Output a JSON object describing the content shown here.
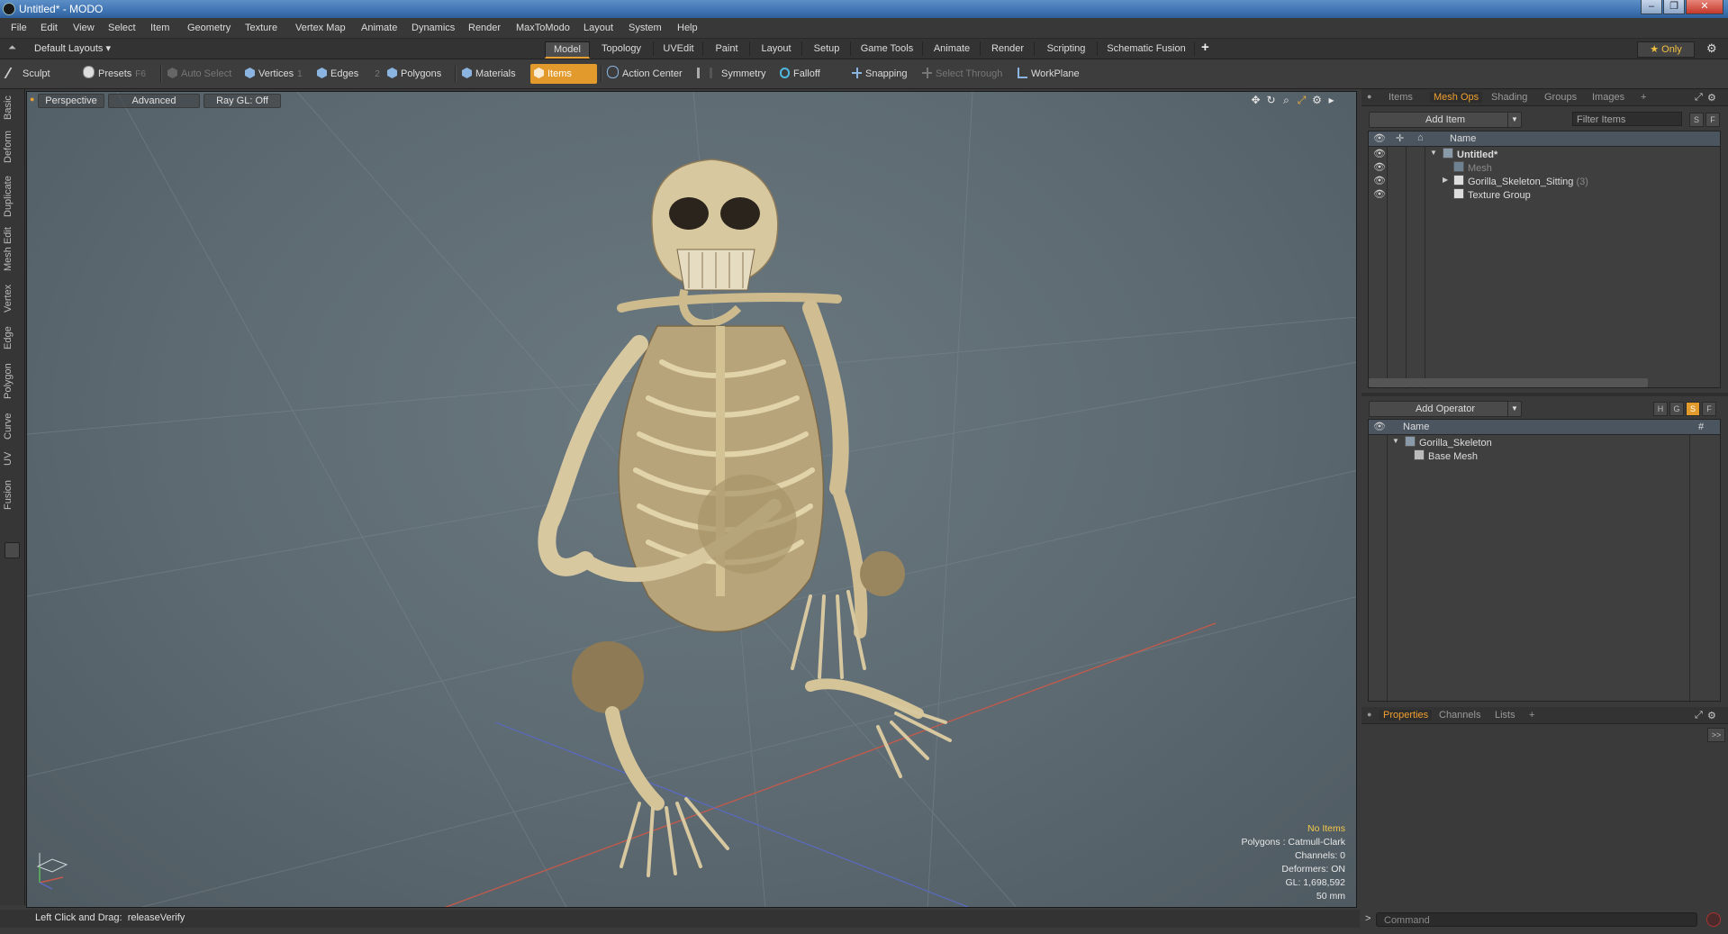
{
  "window": {
    "title": "Untitled* - MODO",
    "buttons": [
      "–",
      "❐",
      "✕"
    ]
  },
  "menubar": {
    "items": [
      "File",
      "Edit",
      "View",
      "Select",
      "Item",
      "Geometry",
      "Texture",
      "Vertex Map",
      "Animate",
      "Dynamics",
      "Render",
      "MaxToModo",
      "Layout",
      "System",
      "Help"
    ]
  },
  "layoutbar": {
    "layouts_label": "Default Layouts ▾",
    "tabs": [
      "Model",
      "Topology",
      "UVEdit",
      "Paint",
      "Layout",
      "Setup",
      "Game Tools",
      "Animate",
      "Render",
      "Scripting",
      "Schematic Fusion"
    ],
    "active_tab": "Model",
    "add_label": "+",
    "only_label": "★ Only",
    "gear": "⚙"
  },
  "toolbar": {
    "sculpt": "Sculpt",
    "presets": "Presets",
    "presets_shortcut": "F6",
    "auto_select": "Auto Select",
    "vertices": "Vertices",
    "vertices_num": "1",
    "edges": "Edges",
    "edges_num": "2",
    "polygons": "Polygons",
    "materials": "Materials",
    "items": "Items",
    "action_center": "Action Center",
    "symmetry": "Symmetry",
    "falloff": "Falloff",
    "snapping": "Snapping",
    "select_through": "Select Through",
    "workplane": "WorkPlane",
    "accent_color": "#e39a2c"
  },
  "left_tabs": [
    "Basic",
    "Deform",
    "Duplicate",
    "Mesh Edit",
    "Vertex",
    "Edge",
    "Polygon",
    "Curve",
    "UV",
    "Fusion"
  ],
  "viewport": {
    "perspective": "Perspective",
    "advanced": "Advanced",
    "raygl": "Ray GL: Off",
    "info": {
      "no_items": "No Items",
      "polygons": "Polygons : Catmull-Clark",
      "channels": "Channels: 0",
      "deformers": "Deformers: ON",
      "gl": "GL: 1,698,592",
      "scale": "50 mm"
    }
  },
  "statusbar": {
    "text": "Left Click and Drag:  releaseVerify"
  },
  "right_panel": {
    "top_tabs": [
      "Items",
      "Mesh Ops",
      "Shading",
      "Groups",
      "Images"
    ],
    "active_top_tab": "Mesh Ops",
    "add_item": "Add Item",
    "filter_items": "Filter Items",
    "s_btn": "S",
    "f_btn": "F",
    "name_header": "Name",
    "tree": [
      {
        "label": "Untitled*",
        "bold": true
      },
      {
        "label": "Mesh",
        "muted": true
      },
      {
        "label": "Gorilla_Skeleton_Sitting",
        "count": "(3)"
      },
      {
        "label": "Texture Group"
      }
    ],
    "add_operator": "Add Operator",
    "op_buttons": [
      "H",
      "G",
      "S",
      "F"
    ],
    "op_name_header": "Name",
    "op_hash_header": "#",
    "operators": [
      {
        "label": "Gorilla_Skeleton"
      },
      {
        "label": "Base Mesh"
      }
    ],
    "bottom_tabs": [
      "Properties",
      "Channels",
      "Lists"
    ],
    "active_bottom_tab": "Properties",
    "expand": ">>",
    "command_placeholder": "Command",
    "prompt": ">"
  }
}
